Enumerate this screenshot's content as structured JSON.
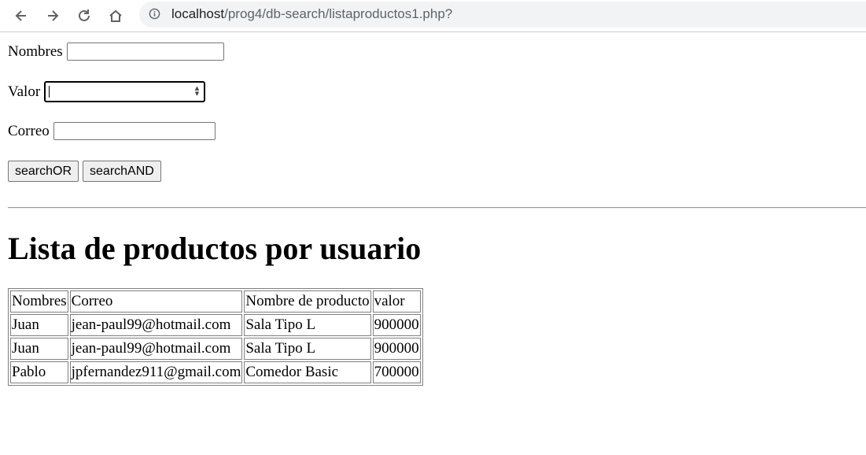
{
  "browser": {
    "url_host": "localhost",
    "url_path": "/prog4/db-search/listaproductos1.php?"
  },
  "form": {
    "nombres_label": "Nombres",
    "nombres_value": "",
    "valor_label": "Valor",
    "valor_value": "",
    "correo_label": "Correo",
    "correo_value": "",
    "search_or_label": "searchOR",
    "search_and_label": "searchAND"
  },
  "page": {
    "heading": "Lista de productos por usuario"
  },
  "table": {
    "headers": [
      "Nombres",
      "Correo",
      "Nombre de producto",
      "valor"
    ],
    "rows": [
      [
        "Juan",
        "jean-paul99@hotmail.com",
        "Sala Tipo L",
        "900000"
      ],
      [
        "Juan",
        "jean-paul99@hotmail.com",
        "Sala Tipo L",
        "900000"
      ],
      [
        "Pablo",
        "jpfernandez911@gmail.com",
        "Comedor Basic",
        "700000"
      ]
    ]
  }
}
